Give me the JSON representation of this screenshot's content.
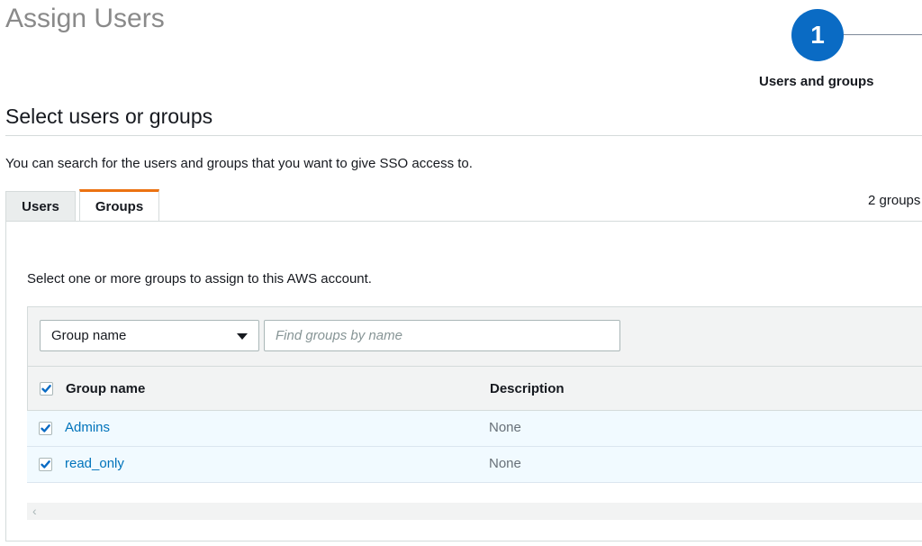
{
  "page": {
    "title": "Assign Users"
  },
  "stepper": {
    "number": "1",
    "label": "Users and groups"
  },
  "section": {
    "title": "Select users or groups",
    "intro": "You can search for the users and groups that you want to give SSO access to."
  },
  "tabs": [
    {
      "label": "Users",
      "active": false
    },
    {
      "label": "Groups",
      "active": true
    }
  ],
  "groups_count": "2 groups",
  "panel": {
    "description": "Select one or more groups to assign to this AWS account."
  },
  "filter": {
    "select_value": "Group name",
    "search_placeholder": "Find groups by name"
  },
  "table": {
    "columns": [
      "Group name",
      "Description"
    ],
    "rows": [
      {
        "name": "Admins",
        "description": "None",
        "checked": true
      },
      {
        "name": "read_only",
        "description": "None",
        "checked": true
      }
    ],
    "header_checked": true
  },
  "colors": {
    "accent": "#0a6bc4",
    "tab_active": "#ec7211",
    "link": "#0073bb",
    "selected_row": "#f1faff"
  },
  "icons": [
    "caret-down-icon",
    "checkmark-icon",
    "chevron-left-icon"
  ]
}
